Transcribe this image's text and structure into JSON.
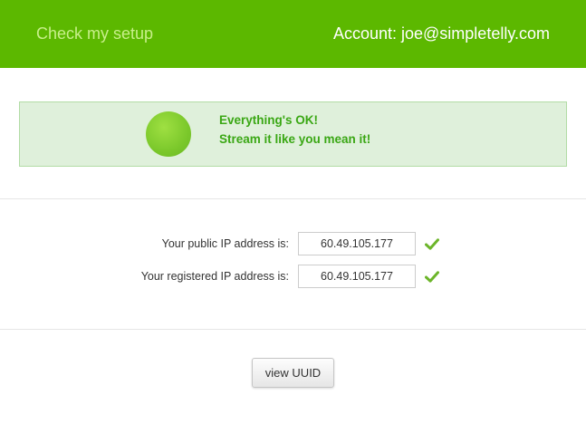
{
  "header": {
    "title": "Check my setup",
    "account": "Account: joe@simpletelly.com"
  },
  "status": {
    "indicator_icon": "status-ok-dot",
    "line1": "Everything's OK!",
    "line2": "Stream it like you mean it!"
  },
  "ip": {
    "public_label": "Your public IP address is:",
    "public_value": "60.49.105.177",
    "registered_label": "Your registered IP address is:",
    "registered_value": "60.49.105.177",
    "check_icon": "checkmark-icon"
  },
  "actions": {
    "uuid_button": "view UUID"
  },
  "colors": {
    "header_bg": "#5cb800",
    "header_title": "#c8ef8a",
    "status_bg": "#dff0db",
    "status_text": "#3aa714",
    "check": "#6cb52a"
  }
}
